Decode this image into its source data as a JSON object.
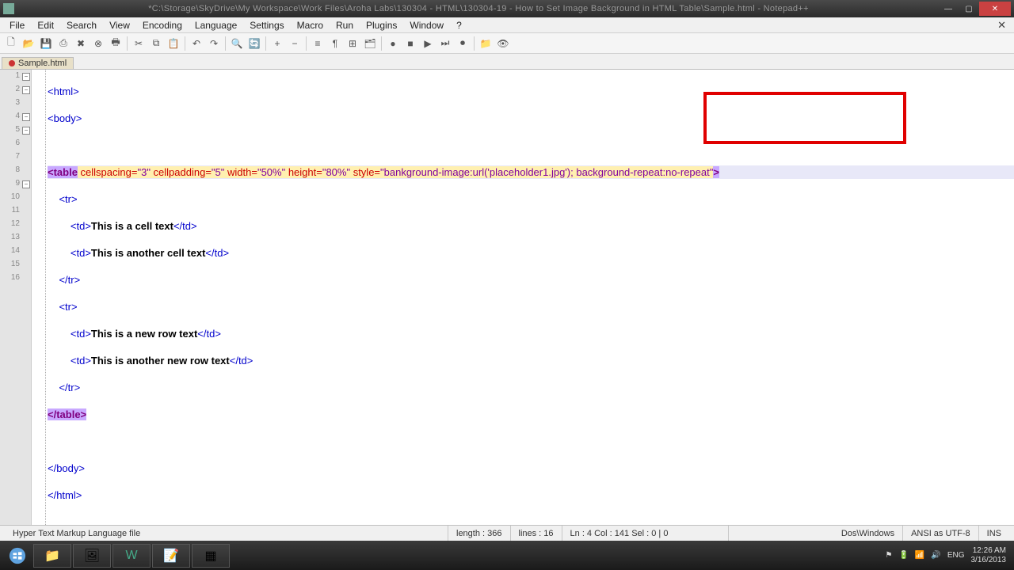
{
  "title": "*C:\\Storage\\SkyDrive\\My Workspace\\Work Files\\Aroha Labs\\130304 - HTML\\130304-19 - How to Set Image Background in HTML Table\\Sample.html - Notepad++",
  "menus": [
    "File",
    "Edit",
    "Search",
    "View",
    "Encoding",
    "Language",
    "Settings",
    "Macro",
    "Run",
    "Plugins",
    "Window",
    "?"
  ],
  "tab": {
    "label": "Sample.html"
  },
  "code": {
    "l1": "<html>",
    "l2": "<body>",
    "l3": "",
    "l4_tag": "<table",
    "l4_a1": " cellspacing=",
    "l4_v1": "\"3\"",
    "l4_a2": " cellpadding=",
    "l4_v2": "\"5\"",
    "l4_a3": " width=",
    "l4_v3": "\"50%\"",
    "l4_a4": " height=",
    "l4_v4": "\"80%\"",
    "l4_a5": " style=",
    "l4_v5a": "\"bankground-image:url('placeholder1.jpg');",
    "l4_v5b": " background-repeat:no-repeat\"",
    "l4_end": ">",
    "l5": "    <tr>",
    "l6a": "        <td>",
    "l6b": "This is a cell text",
    "l6c": "</td>",
    "l7a": "        <td>",
    "l7b": "This is another cell text",
    "l7c": "</td>",
    "l8": "    </tr>",
    "l9": "    <tr>",
    "l10a": "        <td>",
    "l10b": "This is a new row text",
    "l10c": "</td>",
    "l11a": "        <td>",
    "l11b": "This is another new row text",
    "l11c": "</td>",
    "l12": "    </tr>",
    "l13": "</table>",
    "l14": "",
    "l15": "</body>",
    "l16": "</html>"
  },
  "status": {
    "filetype": "Hyper Text Markup Language file",
    "length": "length : 366",
    "lines": "lines : 16",
    "pos": "Ln : 4    Col : 141    Sel : 0 | 0",
    "eol": "Dos\\Windows",
    "enc": "ANSI as UTF-8",
    "mode": "INS"
  },
  "tray": {
    "lang": "ENG",
    "time": "12:26 AM",
    "date": "3/16/2013"
  }
}
